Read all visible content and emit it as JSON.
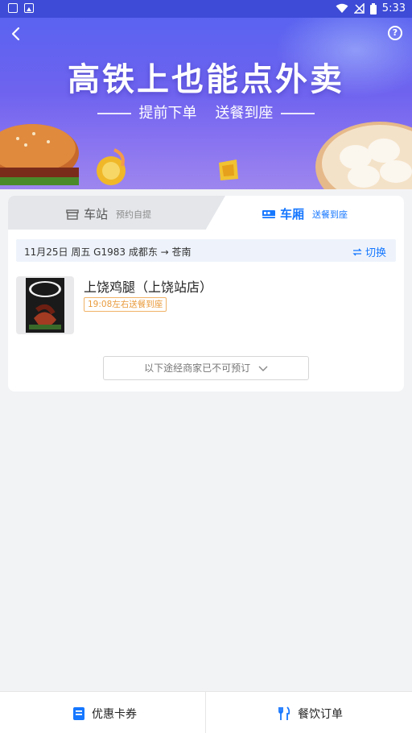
{
  "status_bar": {
    "time": "5:33"
  },
  "banner": {
    "title": "高铁上也能点外卖",
    "subtitle_left": "提前下单",
    "subtitle_right": "送餐到座"
  },
  "tabs": [
    {
      "label": "车站",
      "sublabel": "预约自提",
      "active": false
    },
    {
      "label": "车厢",
      "sublabel": "送餐到座",
      "active": true
    }
  ],
  "trip": {
    "info": "11月25日 周五 G1983 成都东 → 苍南",
    "switch_label": "切换"
  },
  "merchants": [
    {
      "name": "上饶鸡腿（上饶站店）",
      "eta": "19:08左右送餐到座"
    }
  ],
  "unavailable_label": "以下途经商家已不可预订",
  "bottom_nav": [
    {
      "label": "优惠卡券",
      "icon": "coupon-icon"
    },
    {
      "label": "餐饮订单",
      "icon": "fork-knife-icon"
    }
  ],
  "colors": {
    "accent": "#1677ff",
    "banner": "#6f63ef",
    "badge": "#e99b3d"
  }
}
